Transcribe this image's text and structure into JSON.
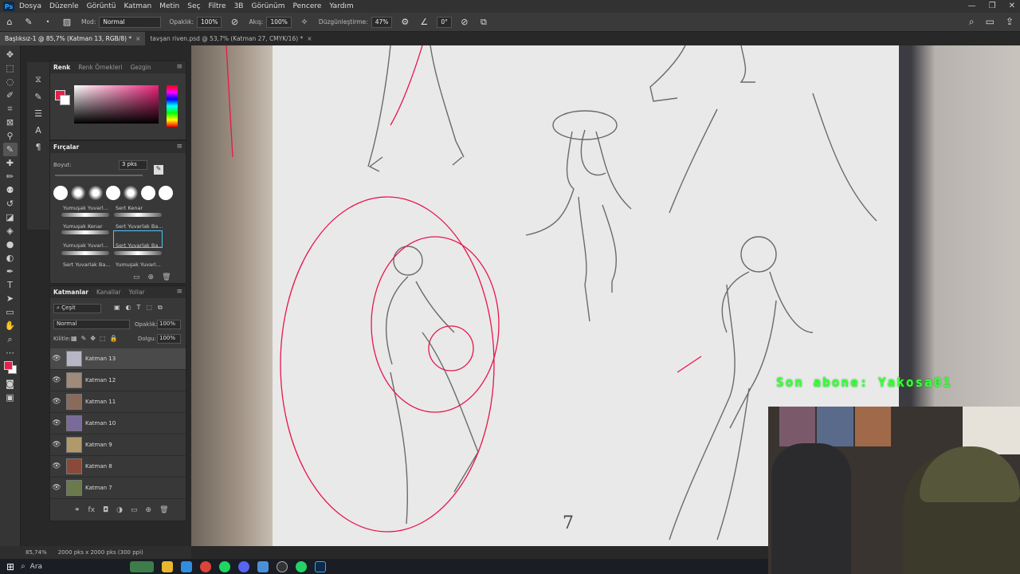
{
  "menubar": {
    "logo": "Ps",
    "items": [
      "Dosya",
      "Düzenle",
      "Görüntü",
      "Katman",
      "Metin",
      "Seç",
      "Filtre",
      "3B",
      "Görünüm",
      "Pencere",
      "Yardım"
    ]
  },
  "options": {
    "mode_label": "Mod:",
    "mode_value": "Normal",
    "opacity_label": "Opaklık:",
    "opacity_value": "100%",
    "flow_label": "Akış:",
    "flow_value": "100%",
    "smoothing_label": "Düzgünleştirme:",
    "smoothing_value": "47%",
    "angle_value": "0°"
  },
  "tabs": [
    {
      "label": "Başlıksız-1 @ 85,7% (Katman 13, RGB/8) *",
      "active": true
    },
    {
      "label": "tavşan riven.psd @ 53,7% (Katman 27, CMYK/16) *",
      "active": false
    }
  ],
  "color_panel": {
    "tabs": [
      "Renk",
      "Renk Örnekleri",
      "Gezgin"
    ],
    "fg_color": "#e3214b",
    "bg_color": "#ffffff"
  },
  "brush_panel": {
    "title": "Fırçalar",
    "size_label": "Boyut:",
    "size_value": "3 pks",
    "brushes": [
      {
        "name": "Yumuşak Yuvarl..."
      },
      {
        "name": "Sert Kenar"
      },
      {
        "name": "Yumuşak Kenar"
      },
      {
        "name": "Sert Yuvarlak Ba..."
      },
      {
        "name": "Yumuşak Yuvarl..."
      },
      {
        "name": "Sert Yuvarlak Ba..."
      },
      {
        "name": "Sert Yuvarlak Ba..."
      },
      {
        "name": "Yumuşak Yuvarl..."
      }
    ]
  },
  "layers_panel": {
    "tabs": [
      "Katmanlar",
      "Kanallar",
      "Yollar"
    ],
    "filter_label": "Çeşit",
    "blend_mode": "Normal",
    "opacity_label": "Opaklık:",
    "opacity_value": "100%",
    "lock_label": "Kilitle:",
    "fill_label": "Dolgu:",
    "fill_value": "100%",
    "layers": [
      {
        "name": "Katman 13",
        "active": true
      },
      {
        "name": "Katman 12",
        "active": false
      },
      {
        "name": "Katman 11",
        "active": false
      },
      {
        "name": "Katman 10",
        "active": false
      },
      {
        "name": "Katman 9",
        "active": false
      },
      {
        "name": "Katman 8",
        "active": false
      },
      {
        "name": "Katman 7",
        "active": false
      }
    ]
  },
  "status": {
    "zoom": "85,74%",
    "doc_info": "2000 pks x 2000 pks (300 ppi)"
  },
  "taskbar": {
    "search_label": "Ara"
  },
  "overlay": {
    "subscriber_text": "Son abone: Yakosa01"
  },
  "canvas": {
    "page_number": "7"
  }
}
